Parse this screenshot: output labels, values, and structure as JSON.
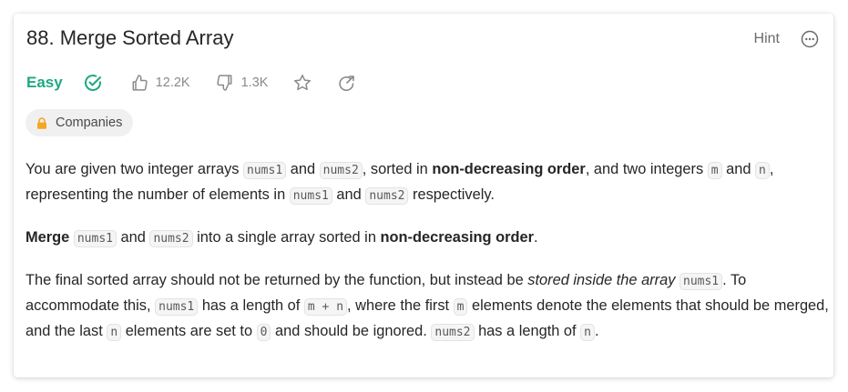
{
  "problem": {
    "title": "88. Merge Sorted Array",
    "difficulty": "Easy",
    "likes": "12.2K",
    "dislikes": "1.3K",
    "companies_label": "Companies"
  },
  "toolbar": {
    "hint_label": "Hint"
  },
  "colors": {
    "easy": "#1fa883",
    "lock": "#f5a623"
  },
  "icons": {
    "solved": "check-circle-icon",
    "like": "thumbs-up-icon",
    "dislike": "thumbs-down-icon",
    "favorite": "star-icon",
    "share": "share-icon",
    "more": "more-dots-icon",
    "lock": "lock-icon"
  },
  "description": {
    "p1": {
      "t1": "You are given two integer arrays ",
      "c1": "nums1",
      "t2": " and ",
      "c2": "nums2",
      "t3": ", sorted in ",
      "b1": "non-decreasing order",
      "t4": ", and two integers ",
      "c3": "m",
      "t5": " and ",
      "c4": "n",
      "t6": ", representing the number of elements in ",
      "c5": "nums1",
      "t7": " and ",
      "c6": "nums2",
      "t8": " respectively."
    },
    "p2": {
      "b1": "Merge",
      "t1": " ",
      "c1": "nums1",
      "t2": " and ",
      "c2": "nums2",
      "t3": " into a single array sorted in ",
      "b2": "non-decreasing order",
      "t4": "."
    },
    "p3": {
      "t1": "The final sorted array should not be returned by the function, but instead be ",
      "i1": "stored inside the array",
      "t2": " ",
      "c1": "nums1",
      "t3": ". To accommodate this, ",
      "c2": "nums1",
      "t4": " has a length of ",
      "c3": "m + n",
      "t5": ", where the first ",
      "c4": "m",
      "t6": " elements denote the elements that should be merged, and the last ",
      "c5": "n",
      "t7": " elements are set to ",
      "c6": "0",
      "t8": " and should be ignored. ",
      "c7": "nums2",
      "t9": " has a length of ",
      "c8": "n",
      "t10": "."
    }
  }
}
